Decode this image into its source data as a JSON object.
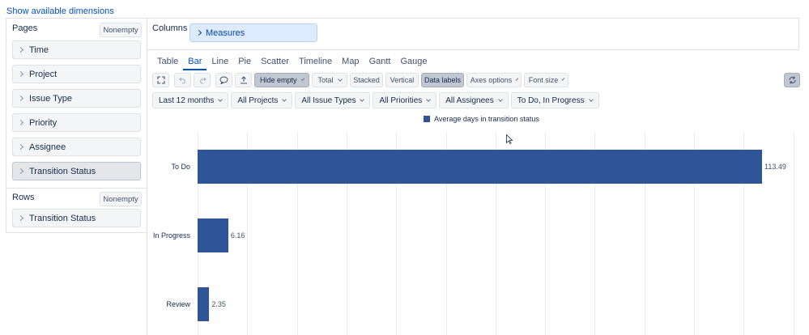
{
  "top_link": "Show available dimensions",
  "pages": {
    "label": "Pages",
    "nonempty": "Nonempty",
    "items": [
      {
        "label": "Time"
      },
      {
        "label": "Project"
      },
      {
        "label": "Issue Type"
      },
      {
        "label": "Priority"
      },
      {
        "label": "Assignee"
      },
      {
        "label": "Transition Status",
        "selected": true
      }
    ]
  },
  "rows": {
    "label": "Rows",
    "nonempty": "Nonempty",
    "items": [
      {
        "label": "Transition Status"
      }
    ]
  },
  "columns": {
    "label": "Columns",
    "items": [
      {
        "label": "Measures"
      }
    ]
  },
  "tabs": [
    "Table",
    "Bar",
    "Line",
    "Pie",
    "Scatter",
    "Timeline",
    "Map",
    "Gantt",
    "Gauge"
  ],
  "active_tab": "Bar",
  "toolbar": {
    "icons": [
      "fullscreen-icon",
      "undo-icon",
      "redo-icon",
      "comment-icon",
      "export-icon"
    ],
    "hide_empty": "Hide empty",
    "total": "Total",
    "stacked": "Stacked",
    "vertical": "Vertical",
    "data_labels": "Data labels",
    "axes_options": "Axes options",
    "font_size": "Font size",
    "refresh_icon": "refresh-icon"
  },
  "filters": [
    "Last 12 months",
    "All Projects",
    "All Issue Types",
    "All Priorities",
    "All Assignees",
    "To Do, In Progress"
  ],
  "chart_data": {
    "type": "bar",
    "orientation": "horizontal",
    "categories": [
      "To Do",
      "In Progress",
      "Review"
    ],
    "series": [
      {
        "name": "Average days in transition status",
        "values": [
          113.49,
          6.16,
          2.35
        ],
        "color": "#2e5597"
      }
    ],
    "data_labels": [
      "113.49",
      "6.16",
      "2.35"
    ],
    "xlim": [
      0,
      113.49
    ],
    "grid": true,
    "legend_position": "top"
  }
}
